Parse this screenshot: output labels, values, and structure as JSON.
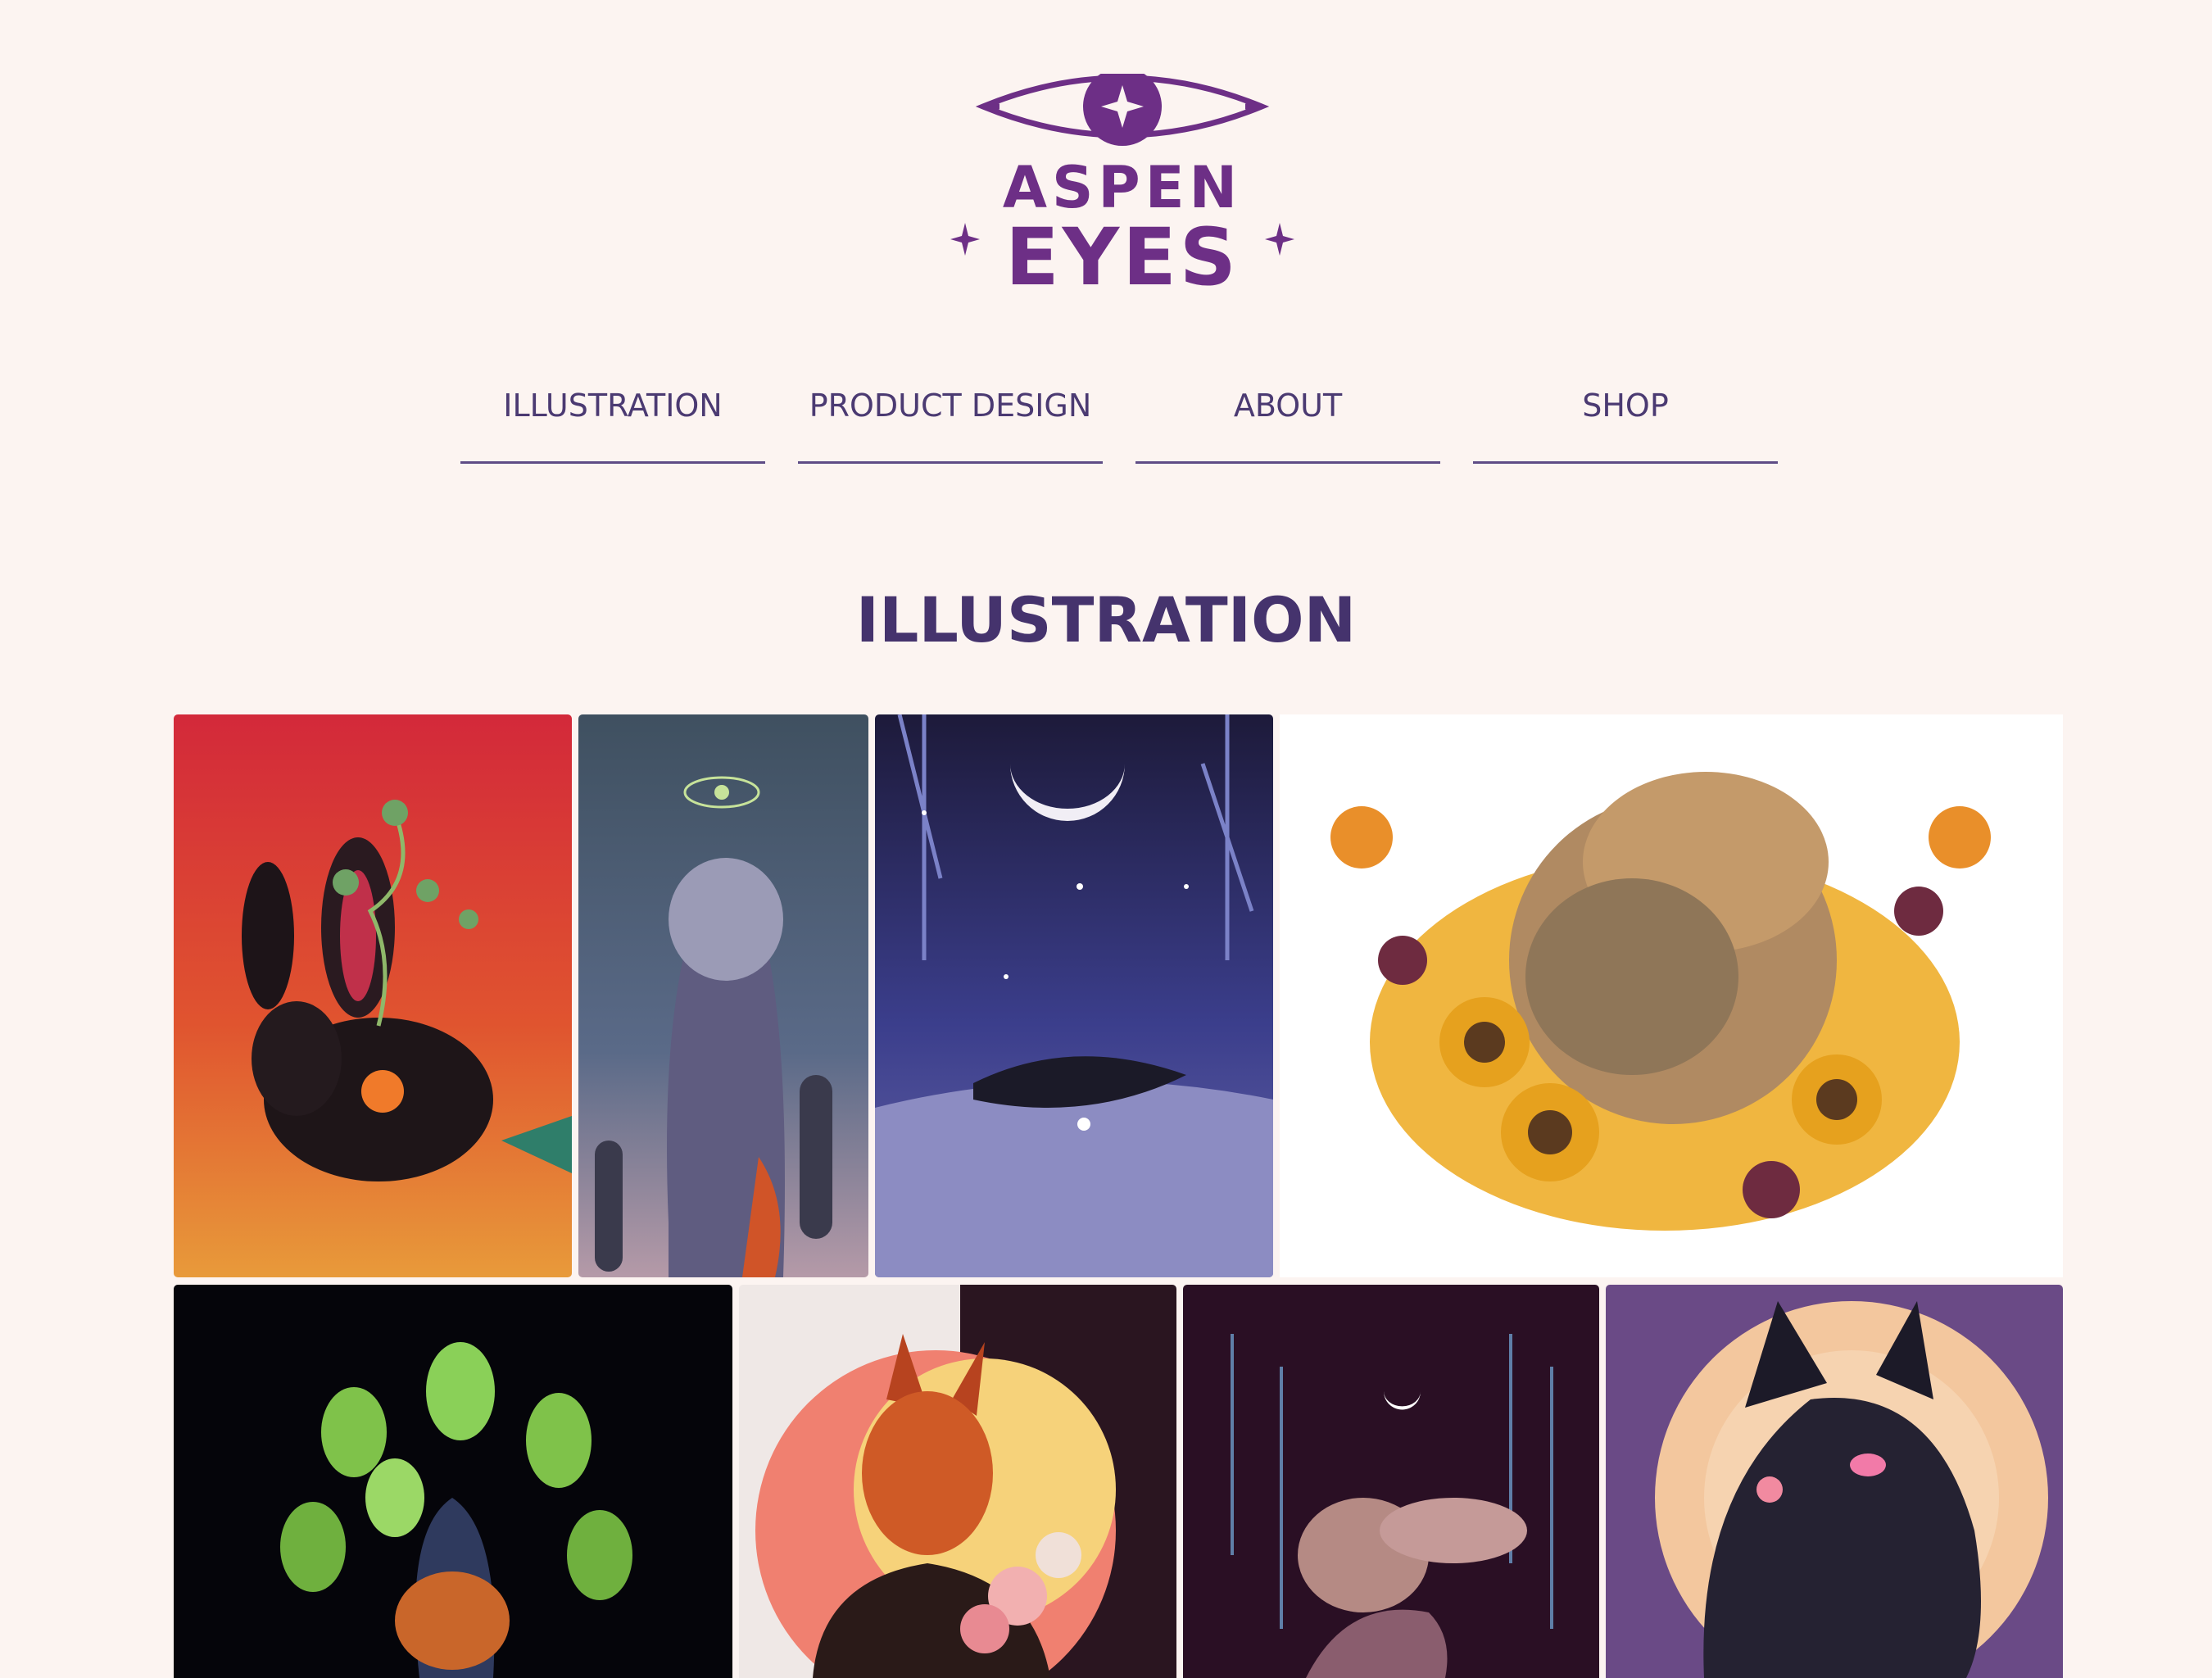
{
  "brand": {
    "line1": "ASPEN",
    "line2": "EYES",
    "color": "#6d2f86"
  },
  "nav": {
    "items": [
      {
        "label": "ILLUSTRATION"
      },
      {
        "label": "PRODUCT DESIGN"
      },
      {
        "label": "ABOUT"
      },
      {
        "label": "SHOP"
      }
    ]
  },
  "main": {
    "title": "ILLUSTRATION"
  },
  "gallery": {
    "tiles": [
      {
        "name": "jackrabbit-red"
      },
      {
        "name": "wolf-cactus-dusk"
      },
      {
        "name": "sleeping-wolf-night"
      },
      {
        "name": "wolves-sunflowers"
      },
      {
        "name": "cactus-wolf-dark"
      },
      {
        "name": "fox-flowers-moon"
      },
      {
        "name": "jackalope-purple-night"
      },
      {
        "name": "black-cat-moon"
      }
    ]
  },
  "colors": {
    "background": "#fcf4f1",
    "nav_text": "#4b3a72",
    "title": "#45336d"
  }
}
